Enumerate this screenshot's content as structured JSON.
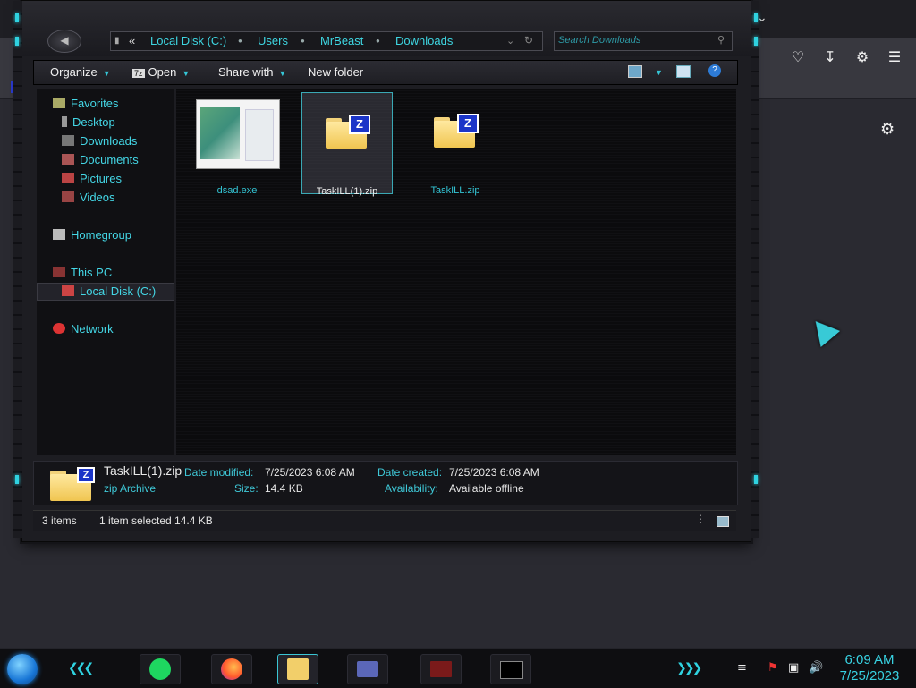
{
  "explorer": {
    "address": {
      "crumbs": [
        "Local Disk (C:)",
        "Users",
        "MrBeast",
        "Downloads"
      ],
      "overflow": "«"
    },
    "search": {
      "placeholder": "Search Downloads"
    },
    "toolbar": {
      "organize": "Organize",
      "open": "Open",
      "share_with": "Share with",
      "new_folder": "New folder"
    },
    "sidebar": {
      "favorites": "Favorites",
      "favorites_items": [
        "Desktop",
        "Downloads",
        "Documents",
        "Pictures",
        "Videos"
      ],
      "homegroup": "Homegroup",
      "this_pc": "This PC",
      "this_pc_items": [
        "Local Disk (C:)"
      ],
      "network": "Network"
    },
    "files": [
      {
        "name": "dsad.exe",
        "icon": "exe-thumbnail",
        "selected": false
      },
      {
        "name": "TaskILL(1).zip",
        "icon": "zip-folder-icon",
        "selected": true
      },
      {
        "name": "TaskILL.zip",
        "icon": "zip-folder-icon",
        "selected": false
      }
    ],
    "details": {
      "name": "TaskILL(1).zip",
      "type": "zip Archive",
      "date_modified_label": "Date modified:",
      "date_modified": "7/25/2023 6:08 AM",
      "size_label": "Size:",
      "size": "14.4 KB",
      "date_created_label": "Date created:",
      "date_created": "7/25/2023 6:08 AM",
      "availability_label": "Availability:",
      "availability": "Available offline"
    },
    "status": {
      "items": "3 items",
      "selection": "1 item selected  14.4 KB"
    }
  },
  "taskbar": {
    "time": "6:09 AM",
    "date": "7/25/2023",
    "apps": [
      "spotify-icon",
      "firefox-icon",
      "file-explorer-icon",
      "card-app-icon",
      "game-app-icon",
      "cmd-icon"
    ]
  },
  "colors": {
    "accent": "#38d2e2",
    "window_bg": "#1d1d22",
    "zip_badge": "#1b35c8"
  }
}
